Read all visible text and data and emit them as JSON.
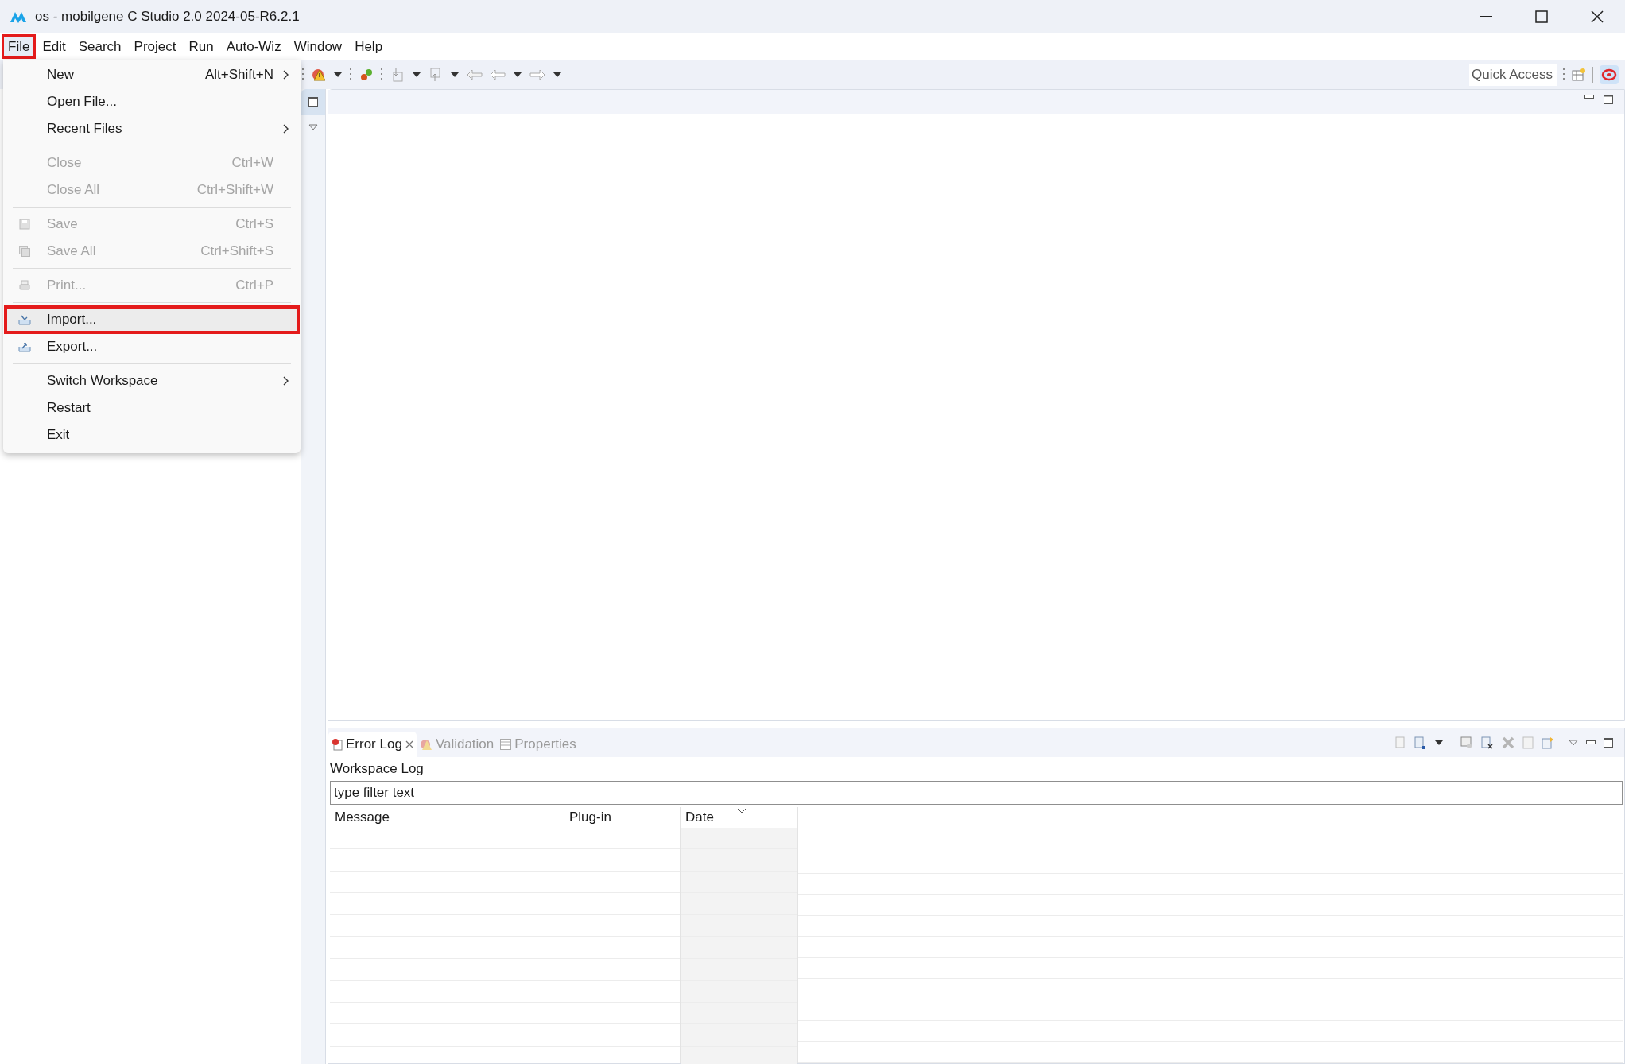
{
  "window": {
    "title": "os - mobilgene C Studio 2.0 2024-05-R6.2.1"
  },
  "menu_bar": [
    {
      "label": "File",
      "open": true,
      "annotated": true
    },
    {
      "label": "Edit",
      "open": false,
      "annotated": false
    },
    {
      "label": "Search",
      "open": false,
      "annotated": false
    },
    {
      "label": "Project",
      "open": false,
      "annotated": false
    },
    {
      "label": "Run",
      "open": false,
      "annotated": false
    },
    {
      "label": "Auto-Wiz",
      "open": false,
      "annotated": false
    },
    {
      "label": "Window",
      "open": false,
      "annotated": false
    },
    {
      "label": "Help",
      "open": false,
      "annotated": false
    }
  ],
  "file_menu": [
    {
      "kind": "item",
      "label": "New",
      "shortcut": "Alt+Shift+N",
      "submenu": true,
      "disabled": false,
      "annotated": false
    },
    {
      "kind": "item",
      "label": "Open File...",
      "submenu": false,
      "disabled": false,
      "annotated": false
    },
    {
      "kind": "item",
      "label": "Recent Files",
      "submenu": true,
      "disabled": false,
      "annotated": false
    },
    {
      "kind": "separator"
    },
    {
      "kind": "item",
      "label": "Close",
      "shortcut": "Ctrl+W",
      "submenu": false,
      "disabled": true,
      "annotated": false
    },
    {
      "kind": "item",
      "label": "Close All",
      "shortcut": "Ctrl+Shift+W",
      "submenu": false,
      "disabled": true,
      "annotated": false
    },
    {
      "kind": "separator"
    },
    {
      "kind": "item",
      "label": "Save",
      "shortcut": "Ctrl+S",
      "submenu": false,
      "disabled": true,
      "annotated": false
    },
    {
      "kind": "item",
      "label": "Save All",
      "shortcut": "Ctrl+Shift+S",
      "submenu": false,
      "disabled": true,
      "annotated": false
    },
    {
      "kind": "separator"
    },
    {
      "kind": "item",
      "label": "Print...",
      "shortcut": "Ctrl+P",
      "submenu": false,
      "disabled": true,
      "annotated": false
    },
    {
      "kind": "separator"
    },
    {
      "kind": "item",
      "label": "Import...",
      "submenu": false,
      "disabled": false,
      "annotated": true
    },
    {
      "kind": "item",
      "label": "Export...",
      "submenu": false,
      "disabled": false,
      "annotated": false
    },
    {
      "kind": "separator"
    },
    {
      "kind": "item",
      "label": "Switch Workspace",
      "submenu": true,
      "disabled": false,
      "annotated": false
    },
    {
      "kind": "item",
      "label": "Restart",
      "submenu": false,
      "disabled": false,
      "annotated": false
    },
    {
      "kind": "item",
      "label": "Exit",
      "submenu": false,
      "disabled": false,
      "annotated": false
    }
  ],
  "quick_access": {
    "placeholder": "Quick Access"
  },
  "bottom_panel": {
    "tabs": [
      {
        "label": "Error Log",
        "selected": true,
        "closable": true
      },
      {
        "label": "Validation",
        "selected": false,
        "closable": false
      },
      {
        "label": "Properties",
        "selected": false,
        "closable": false
      }
    ],
    "log_title": "Workspace Log",
    "filter": {
      "value": "type filter text"
    },
    "table": {
      "columns": [
        {
          "label": "Message",
          "sorted": false
        },
        {
          "label": "Plug-in",
          "sorted": false
        },
        {
          "label": "Date",
          "sorted": true
        }
      ]
    }
  }
}
